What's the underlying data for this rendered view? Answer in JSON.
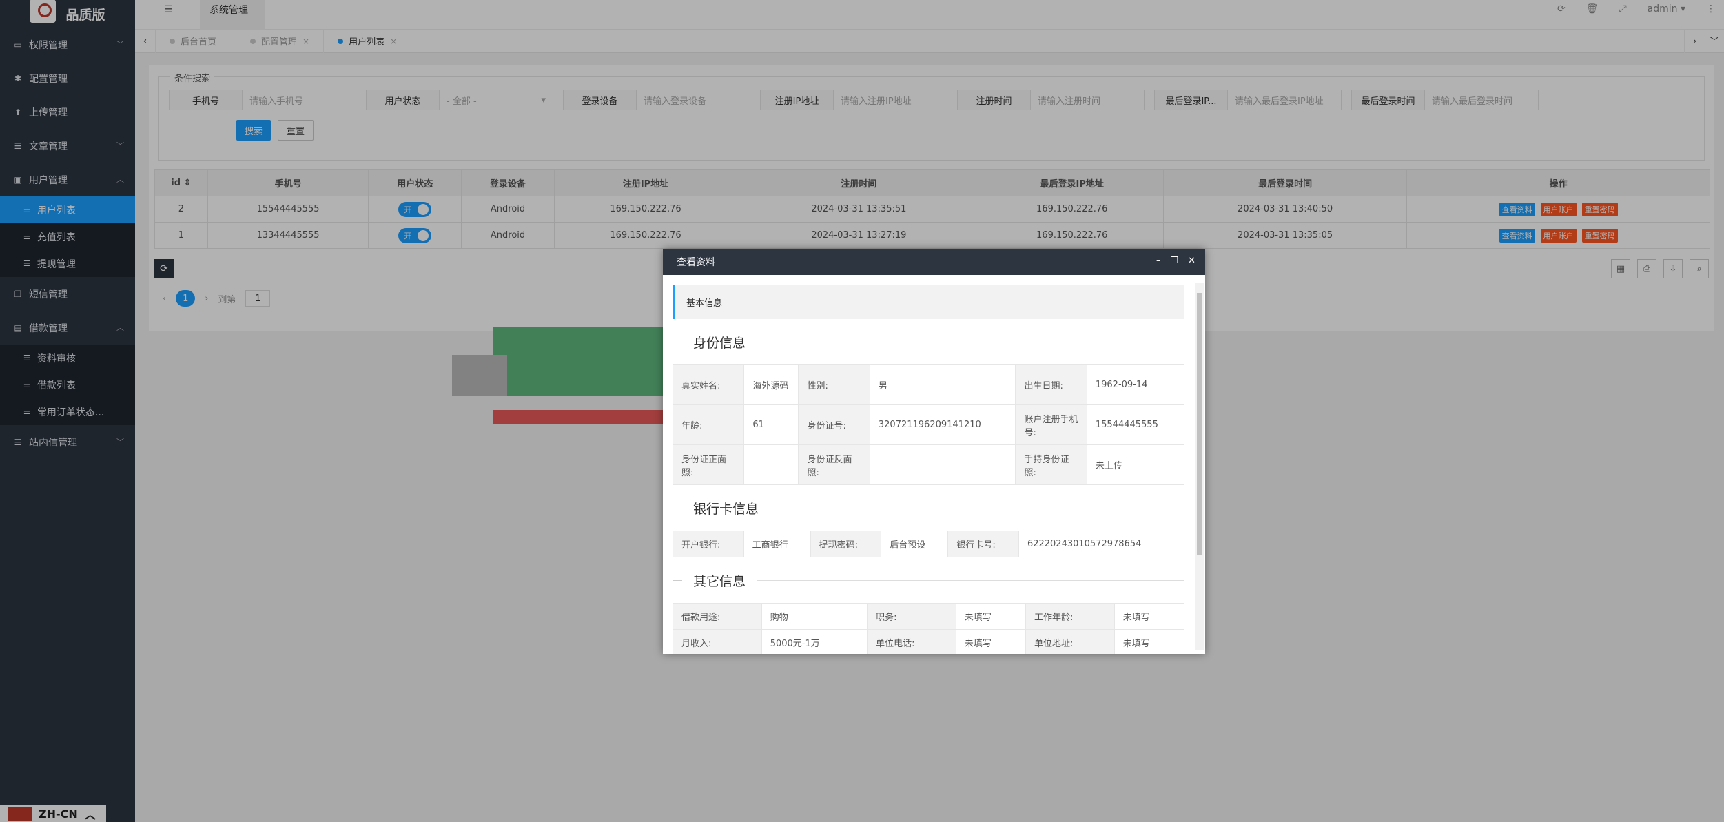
{
  "brand": {
    "title": "品质版"
  },
  "sidebar": {
    "items": [
      {
        "label": "权限管理",
        "icon": "laptop-icon",
        "chev": "﹀"
      },
      {
        "label": "配置管理",
        "icon": "gear-icon",
        "chev": ""
      },
      {
        "label": "上传管理",
        "icon": "upload-icon",
        "chev": ""
      },
      {
        "label": "文章管理",
        "icon": "list-icon",
        "chev": "﹀"
      },
      {
        "label": "用户管理",
        "icon": "user-icon",
        "chev": "︿"
      }
    ],
    "user_sub": [
      {
        "label": "用户列表",
        "active": true
      },
      {
        "label": "充值列表",
        "active": false
      },
      {
        "label": "提现管理",
        "active": false
      }
    ],
    "items2": [
      {
        "label": "短信管理",
        "icon": "copy-icon",
        "chev": ""
      },
      {
        "label": "借款管理",
        "icon": "money-icon",
        "chev": "︿"
      }
    ],
    "loan_sub": [
      {
        "label": "资料审核"
      },
      {
        "label": "借款列表"
      },
      {
        "label": "常用订单状态..."
      }
    ],
    "items3": [
      {
        "label": "站内信管理",
        "icon": "list-icon",
        "chev": "﹀"
      }
    ]
  },
  "lang": {
    "label": "ZH-CN"
  },
  "topbar": {
    "tab": "系统管理",
    "user": "admin ▾"
  },
  "tabs": [
    {
      "label": "后台首页",
      "close": ""
    },
    {
      "label": "配置管理",
      "close": "×"
    },
    {
      "label": "用户列表",
      "close": "×",
      "active": true
    }
  ],
  "search": {
    "legend": "条件搜索",
    "fields": [
      {
        "label": "手机号",
        "placeholder": "请输入手机号"
      },
      {
        "label": "用户状态",
        "placeholder": "- 全部 -",
        "select": true
      },
      {
        "label": "登录设备",
        "placeholder": "请输入登录设备"
      },
      {
        "label": "注册IP地址",
        "placeholder": "请输入注册IP地址"
      },
      {
        "label": "注册时间",
        "placeholder": "请输入注册时间"
      },
      {
        "label": "最后登录IP...",
        "placeholder": "请输入最后登录IP地址"
      },
      {
        "label": "最后登录时间",
        "placeholder": "请输入最后登录时间"
      }
    ],
    "search_btn": "搜索",
    "reset_btn": "重置"
  },
  "table": {
    "headers": [
      "id ⇕",
      "手机号",
      "用户状态",
      "登录设备",
      "注册IP地址",
      "注册时间",
      "最后登录IP地址",
      "最后登录时间",
      "操作"
    ],
    "rows": [
      {
        "id": "2",
        "phone": "15544445555",
        "status": "开",
        "device": "Android",
        "reg_ip": "169.150.222.76",
        "reg_time": "2024-03-31 13:35:51",
        "last_ip": "169.150.222.76",
        "last_time": "2024-03-31 13:40:50"
      },
      {
        "id": "1",
        "phone": "13344445555",
        "status": "开",
        "device": "Android",
        "reg_ip": "169.150.222.76",
        "reg_time": "2024-03-31 13:27:19",
        "last_ip": "169.150.222.76",
        "last_time": "2024-03-31 13:35:05"
      }
    ],
    "actions": [
      "查看资料",
      "用户账户",
      "重置密码"
    ]
  },
  "pager": {
    "current": "1",
    "goto": "到第",
    "input": "1"
  },
  "modal": {
    "title": "查看资料",
    "section": "基本信息",
    "identity_title": "身份信息",
    "identity": [
      [
        "真实姓名:",
        "海外源码",
        "性别:",
        "男",
        "出生日期:",
        "1962-09-14"
      ],
      [
        "年龄:",
        "61",
        "身份证号:",
        "320721196209141210",
        "账户注册手机号:",
        "15544445555"
      ],
      [
        "身份证正面照:",
        "",
        "身份证反面照:",
        "",
        "手持身份证照:",
        "未上传"
      ]
    ],
    "bank_title": "银行卡信息",
    "bank": [
      "开户银行:",
      "工商银行",
      "提现密码:",
      "后台预设",
      "银行卡号:",
      "6222024301057297865​4"
    ],
    "other_title": "其它信息",
    "other": [
      [
        "借款用途:",
        "购物",
        "职务:",
        "未填写",
        "工作年龄:",
        "未填写"
      ],
      [
        "月收入:",
        "5000元-1万",
        "单位电话:",
        "未填写",
        "单位地址:",
        "未填写"
      ]
    ]
  }
}
